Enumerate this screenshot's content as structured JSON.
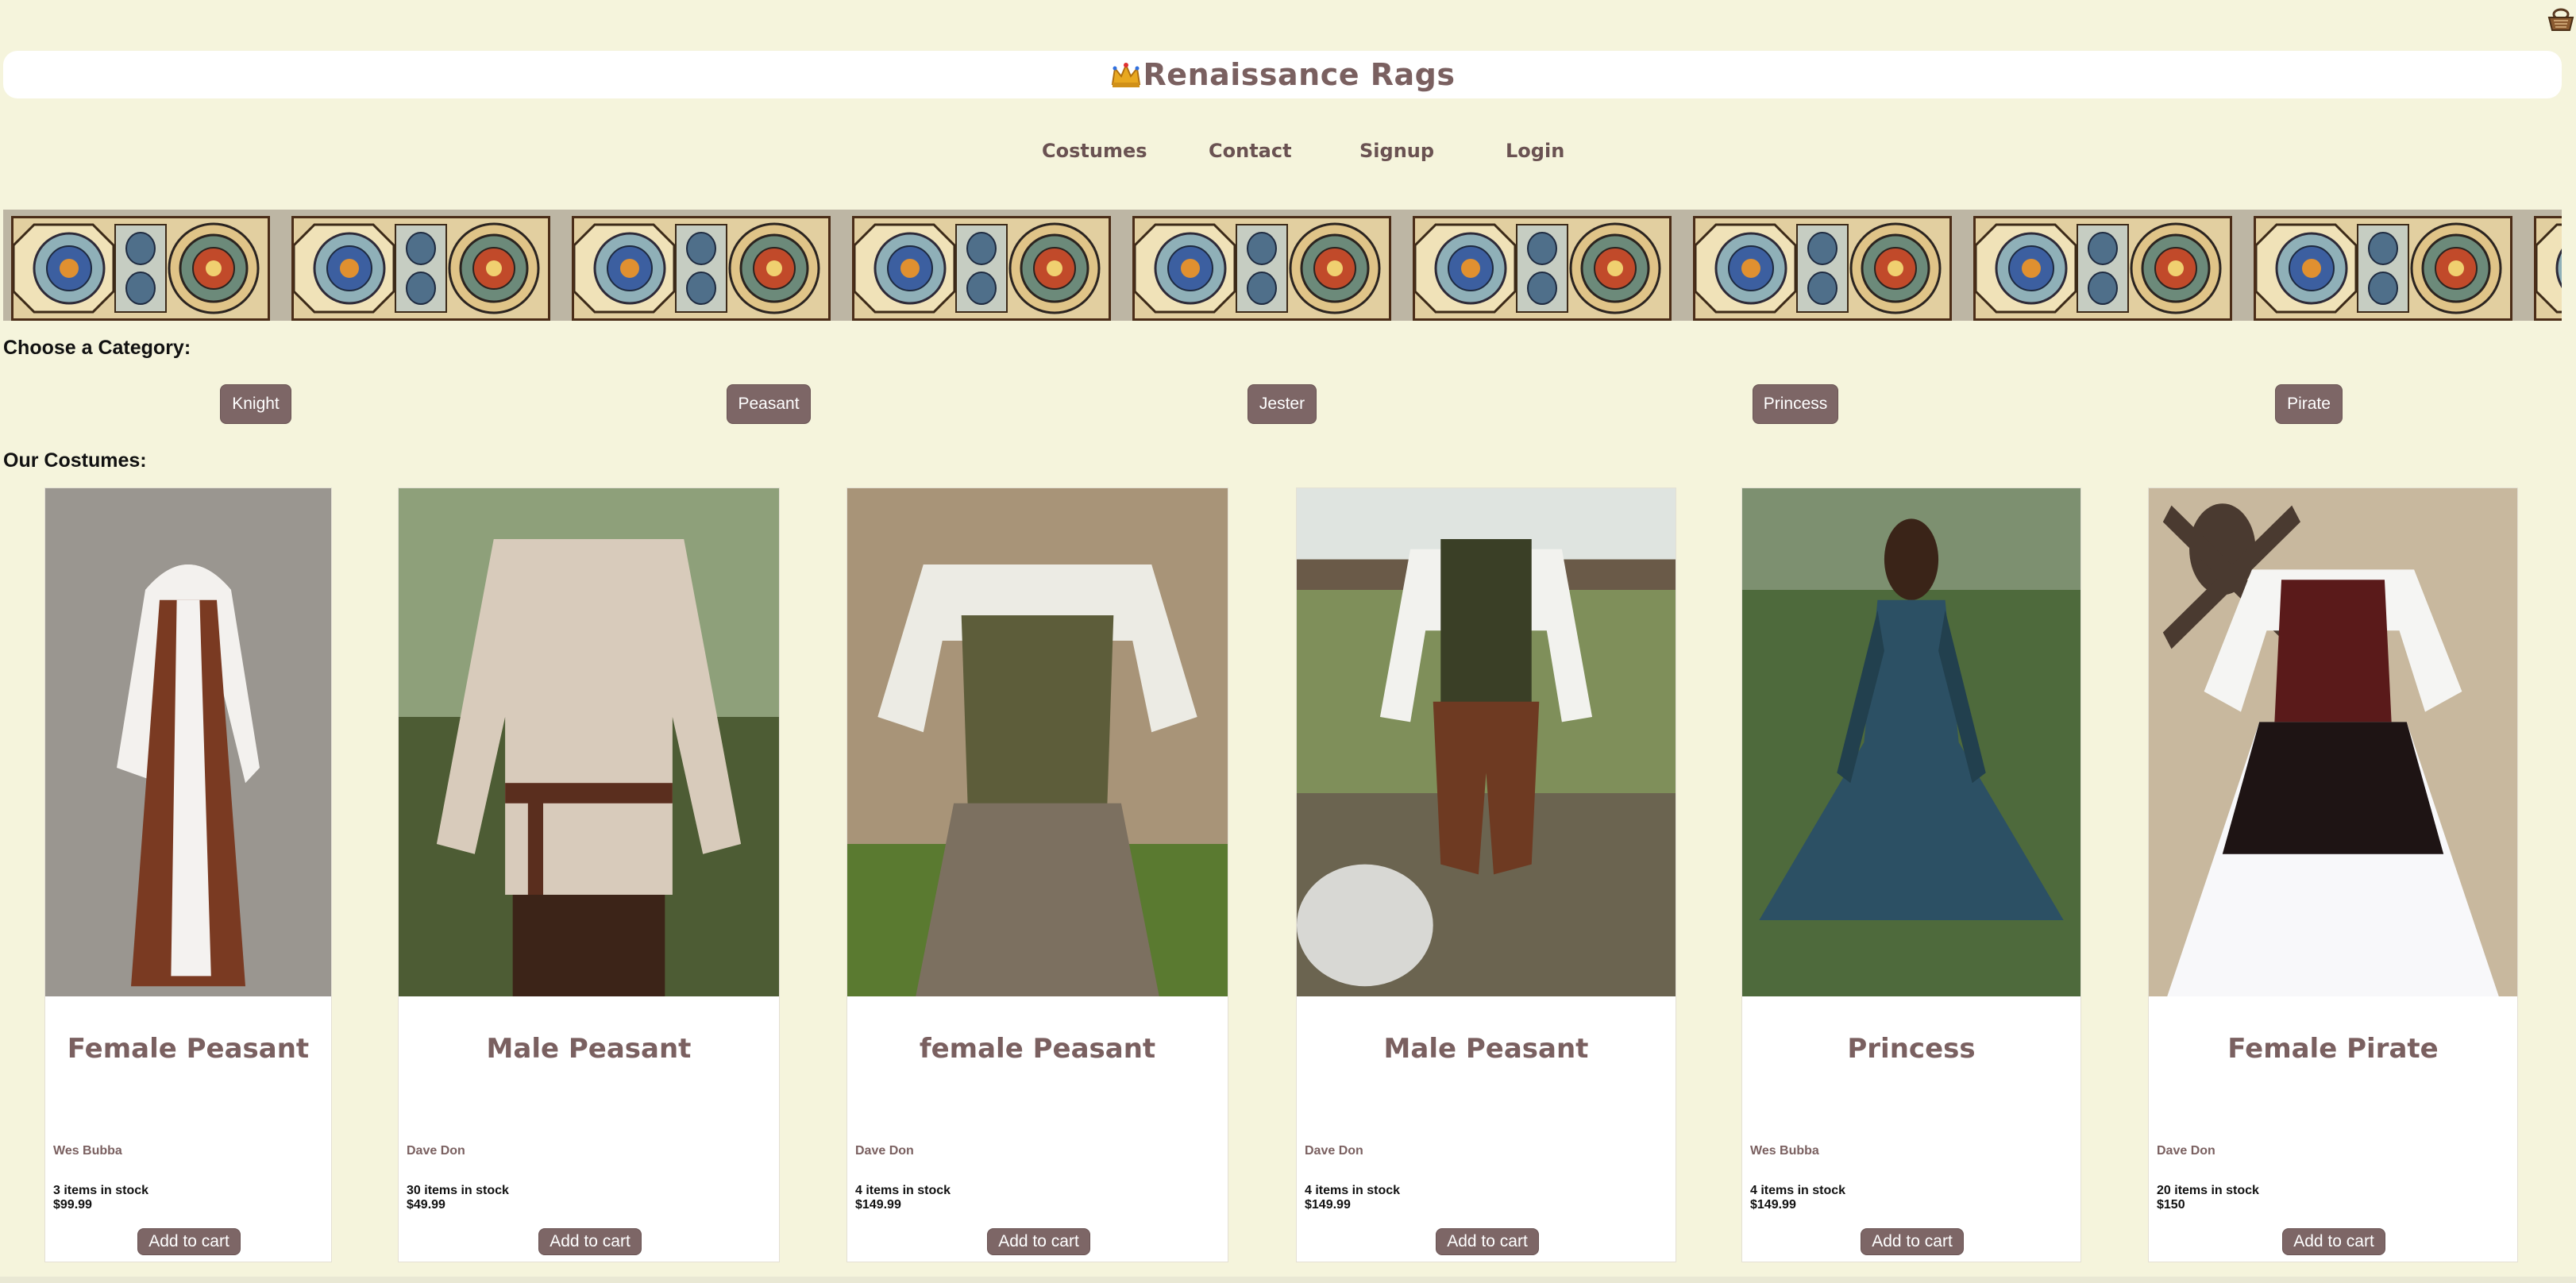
{
  "header": {
    "title": "Renaissance Rags",
    "crown_icon": "crown-icon"
  },
  "nav": [
    "Costumes",
    "Contact",
    "Signup",
    "Login"
  ],
  "cart_icon": "basket-icon",
  "categories": {
    "heading": "Choose a Category:",
    "items": [
      "Knight",
      "Peasant",
      "Jester",
      "Princess",
      "Pirate"
    ]
  },
  "costumes": {
    "heading": "Our Costumes:",
    "add_label": "Add to cart",
    "items": [
      {
        "name": "Female Peasant",
        "seller": "Wes Bubba",
        "stock": "3 items in stock",
        "price": "$99.99"
      },
      {
        "name": "Male Peasant",
        "seller": "Dave Don",
        "stock": "30 items in stock",
        "price": "$49.99"
      },
      {
        "name": "female Peasant",
        "seller": "Dave Don",
        "stock": "4 items in stock",
        "price": "$149.99"
      },
      {
        "name": "Male Peasant",
        "seller": "Dave Don",
        "stock": "4 items in stock",
        "price": "$149.99"
      },
      {
        "name": "Princess",
        "seller": "Wes Bubba",
        "stock": "4 items in stock",
        "price": "$149.99"
      },
      {
        "name": "Female Pirate",
        "seller": "Dave Don",
        "stock": "20 items in stock",
        "price": "$150"
      }
    ]
  },
  "colors": {
    "background": "#f5f4dc",
    "accent": "#7d6666",
    "title_text": "#7a6060"
  }
}
